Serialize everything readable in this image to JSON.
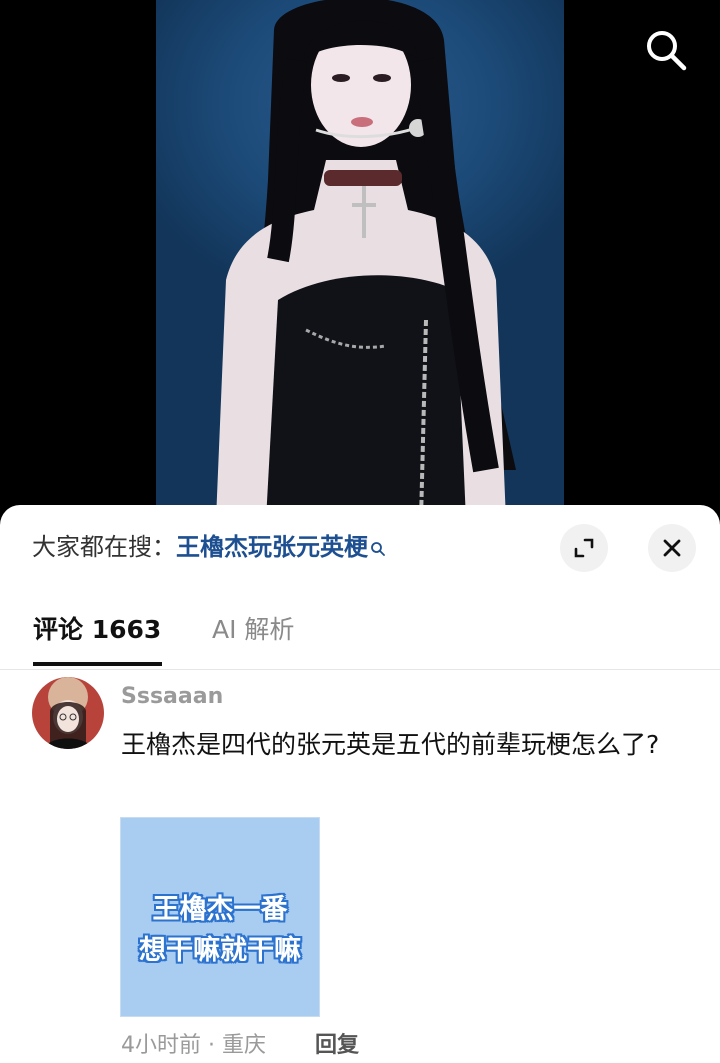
{
  "video": {
    "search_icon": "search-icon"
  },
  "sheet": {
    "search_hint": {
      "prefix": "大家都在搜：",
      "term": "王櫓杰玩张元英梗",
      "icon": "search-icon"
    },
    "expand_icon": "expand-icon",
    "close_icon": "close-icon",
    "tabs": [
      {
        "label": "评论 1663",
        "active": true
      },
      {
        "label": "AI 解析",
        "active": false
      }
    ]
  },
  "comments": [
    {
      "username": "Sssaaan",
      "text": "王櫓杰是四代的张元英是五代的前辈玩梗怎么了?",
      "image_text": [
        "王櫓杰一番",
        "想干嘛就干嘛"
      ],
      "meta": "4小时前 · 重庆",
      "reply_label": "回复"
    }
  ],
  "colors": {
    "link": "#1d4f91",
    "muted": "#9a9a9a",
    "sticker_bg": "#a9ccf1",
    "sticker_outline": "#2c73cf"
  }
}
